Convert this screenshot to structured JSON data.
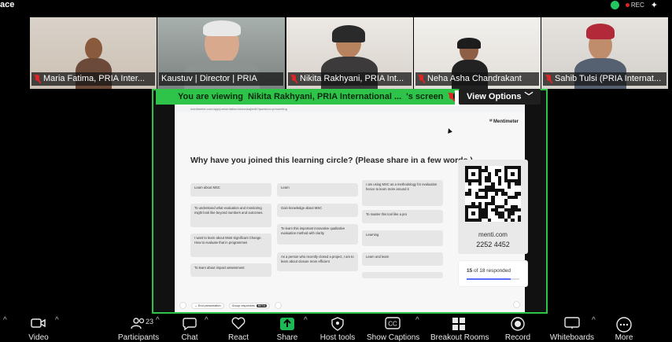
{
  "window": {
    "title_fragment": "ace",
    "rec_label": "REC"
  },
  "participants_strip": [
    {
      "name": "Maria Fatima, PRIA Inter...",
      "muted": true
    },
    {
      "name": "Kaustuv | Director | PRIA",
      "muted": false,
      "active": true
    },
    {
      "name": "Nikita Rakhyani, PRIA Int...",
      "muted": true
    },
    {
      "name": "Neha Asha Chandrakant",
      "muted": true
    },
    {
      "name": "Sahib Tulsi (PRIA Internat...",
      "muted": true
    }
  ],
  "share_banner": {
    "prefix": "You are viewing",
    "name": "Nikita Rakhyani, PRIA International ...",
    "suffix": "'s screen",
    "view_options": "View Options"
  },
  "browser": {
    "url": "mentimeter.com/app/presentation/alvesxkaj/edit?question=presenting"
  },
  "slide": {
    "brand": "Mentimeter",
    "question": "Why have you joined this learning circle? (Please share in a few words.)",
    "responses": [
      "Learn about MSC",
      "To understand what evaluation and monitoring might look like beyond numbers and outcomes.",
      "I want to learn about Most Significant Change. How to evaluate that in programmes",
      "To learn about impact assessment",
      "Learn",
      "Gain knowledge about MSC",
      "To learn this important innovative qualitative evaluation method with clarity",
      "As a person who recently closed a project, I am to learn about closure more efficient",
      "I am using MSC as a methodology for evaluation hence to learn more around it",
      "To master this tool like a pro",
      "Learning",
      "Learn and learn",
      ""
    ],
    "join_url": "menti.com",
    "join_code": "2252 4452",
    "responded_count": "15",
    "responded_total": "of 18 responded",
    "responded_fraction": 0.83,
    "end_label": "End presentation",
    "group_label": "Group responses",
    "group_tag": "BETA"
  },
  "toolbar": {
    "video": "Video",
    "participants": "Participants",
    "participants_count": "23",
    "chat": "Chat",
    "react": "React",
    "share": "Share",
    "host_tools": "Host tools",
    "captions": "Show Captions",
    "breakout": "Breakout Rooms",
    "record": "Record",
    "whiteboards": "Whiteboards",
    "more": "More"
  },
  "colors": {
    "active_green": "#2ec44a",
    "mute_red": "#e02424",
    "toolbar_bg": "#000000",
    "share_green": "#1db954"
  }
}
